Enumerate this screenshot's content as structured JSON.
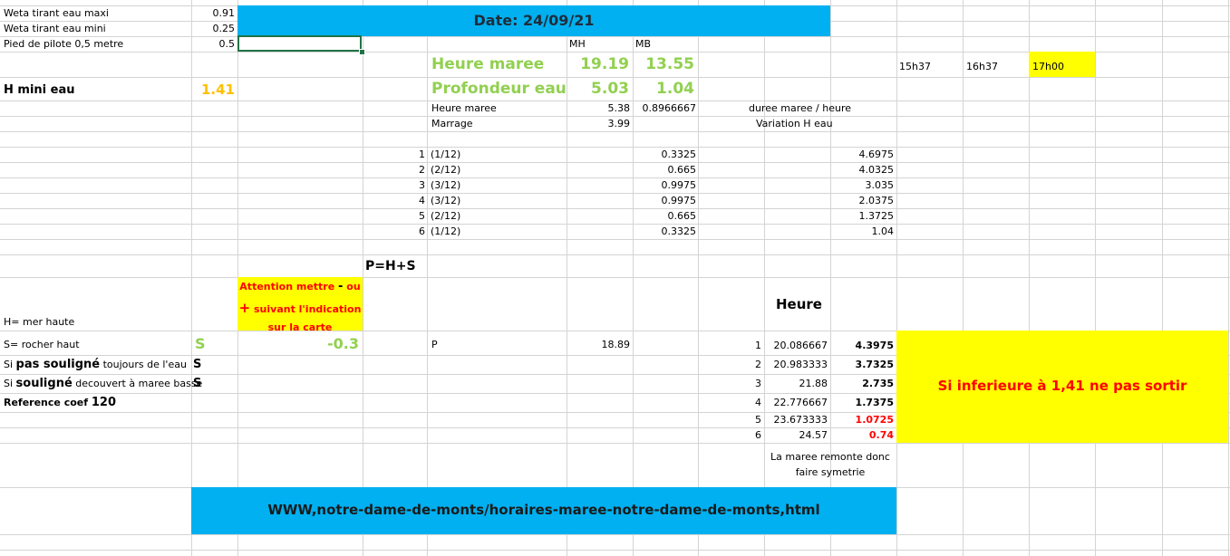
{
  "sheet": {
    "rows": [
      {
        "label": "Weta tirant eau   maxi",
        "value": "0.91"
      },
      {
        "label": "Weta tirant eau   mini",
        "value": "0.25"
      },
      {
        "label": "Pied de pilote 0,5 metre",
        "value": "0.5"
      }
    ],
    "date_banner": "Date: 24/09/21",
    "mh": "MH",
    "mb": "MB",
    "heure_maree_big": {
      "label": "Heure maree",
      "mh": "19.19",
      "mb": "13.55"
    },
    "profondeur": {
      "label": "Profondeur eau",
      "mh": "5.03",
      "mb": "1.04"
    },
    "hmini": {
      "label": "H mini eau",
      "value": "1.41"
    },
    "times": [
      "15h37",
      "16h37",
      "17h00"
    ],
    "heure_maree_small": {
      "label": "Heure maree",
      "a": "5.38",
      "b": "0.8966667"
    },
    "marrage": {
      "label": "Marrage",
      "a": "3.99"
    },
    "duree": "duree maree / heure",
    "variation": "Variation  H eau",
    "twelfths": [
      {
        "n": "1",
        "frac": "(1/12)",
        "v": "0.3325",
        "h": "4.6975"
      },
      {
        "n": "2",
        "frac": "(2/12)",
        "v": "0.665",
        "h": "4.0325"
      },
      {
        "n": "3",
        "frac": "(3/12)",
        "v": "0.9975",
        "h": "3.035"
      },
      {
        "n": "4",
        "frac": "(3/12)",
        "v": "0.9975",
        "h": "2.0375"
      },
      {
        "n": "5",
        "frac": "(2/12)",
        "v": "0.665",
        "h": "1.3725"
      },
      {
        "n": "6",
        "frac": "(1/12)",
        "v": "0.3325",
        "h": "1.04"
      }
    ],
    "formula": "P=H+S",
    "attention": {
      "line1": "Attention mettre",
      "minus": "-",
      "ou": "ou",
      "plus": "+",
      "line2": "suivant l'indication",
      "line3": "sur la carte"
    },
    "heure_label": "Heure",
    "h_mer_haute": "H= mer haute",
    "s_rocher": {
      "label": "S= rocher haut",
      "s": "S",
      "value": "-0.3"
    },
    "p_label": "P",
    "p_value": "18.89",
    "pas_souligne": {
      "pre": "Si ",
      "bold": "pas souligné",
      "post": " toujours de l'eau",
      "s": "S"
    },
    "souligne": {
      "pre": "Si ",
      "bold": "souligné",
      "post": " decouvert à maree basse",
      "s": "S"
    },
    "reference": {
      "label": "Reference coef ",
      "value": "120"
    },
    "hours": [
      {
        "n": "1",
        "h": "20.086667",
        "v": "4.3975"
      },
      {
        "n": "2",
        "h": "20.983333",
        "v": "3.7325"
      },
      {
        "n": "3",
        "h": "21.88",
        "v": "2.735"
      },
      {
        "n": "4",
        "h": "22.776667",
        "v": "1.7375"
      },
      {
        "n": "5",
        "h": "23.673333",
        "v": "1.0725"
      },
      {
        "n": "6",
        "h": "24.57",
        "v": "0.74"
      }
    ],
    "warning": "Si  inferieure à 1,41 ne pas  sortir",
    "remonte_1": "La maree remonte donc",
    "remonte_2": "faire symetrie",
    "url_banner": "WWW,notre-dame-de-monts/horaires-maree-notre-dame-de-monts,html"
  },
  "colors": {
    "banner_blue": "#00b0f0",
    "yellow": "#ffff00",
    "green": "#92d050",
    "orange": "#ffc000",
    "red": "#ff0000",
    "grid": "#d4d4d4"
  }
}
